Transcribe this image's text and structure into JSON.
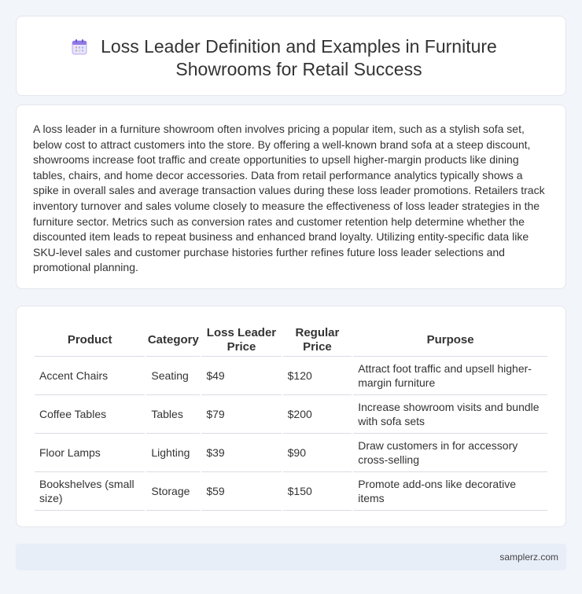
{
  "header": {
    "title": "Loss Leader Definition and Examples in Furniture Showrooms for Retail Success",
    "icon": "calendar-icon"
  },
  "intro": {
    "text": "A loss leader in a furniture showroom often involves pricing a popular item, such as a stylish sofa set, below cost to attract customers into the store. By offering a well-known brand sofa at a steep discount, showrooms increase foot traffic and create opportunities to upsell higher-margin products like dining tables, chairs, and home decor accessories. Data from retail performance analytics typically shows a spike in overall sales and average transaction values during these loss leader promotions. Retailers track inventory turnover and sales volume closely to measure the effectiveness of loss leader strategies in the furniture sector. Metrics such as conversion rates and customer retention help determine whether the discounted item leads to repeat business and enhanced brand loyalty. Utilizing entity-specific data like SKU-level sales and customer purchase histories further refines future loss leader selections and promotional planning."
  },
  "table": {
    "headers": [
      "Product",
      "Category",
      "Loss Leader Price",
      "Regular Price",
      "Purpose"
    ],
    "rows": [
      [
        "Accent Chairs",
        "Seating",
        "$49",
        "$120",
        "Attract foot traffic and upsell higher-margin furniture"
      ],
      [
        "Coffee Tables",
        "Tables",
        "$79",
        "$200",
        "Increase showroom visits and bundle with sofa sets"
      ],
      [
        "Floor Lamps",
        "Lighting",
        "$39",
        "$90",
        "Draw customers in for accessory cross-selling"
      ],
      [
        "Bookshelves (small size)",
        "Storage",
        "$59",
        "$150",
        "Promote add-ons like decorative items"
      ]
    ]
  },
  "footer": {
    "site": "samplerz.com"
  }
}
